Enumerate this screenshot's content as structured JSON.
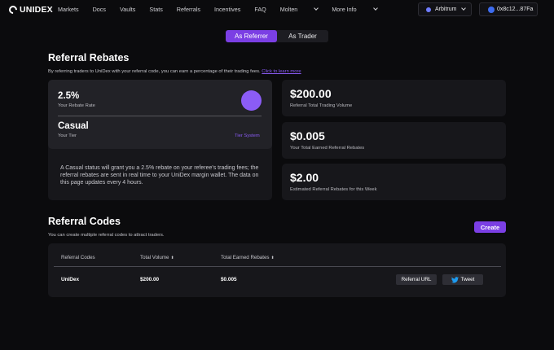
{
  "nav": {
    "brand": "UNIDEX",
    "links": [
      "Markets",
      "Docs",
      "Vaults",
      "Stats",
      "Referrals",
      "Incentives",
      "FAQ",
      "Molten",
      "More Info"
    ],
    "network": "Arbitrum",
    "wallet": "0x8c12...87Fa"
  },
  "toggle": {
    "referrer": "As Referrer",
    "trader": "As Trader",
    "active": "referrer"
  },
  "rebates": {
    "title": "Referral Rebates",
    "subtitle": "By referring traders to UniDex with your referral code, you can earn a percentage of their trading fees.",
    "learn_more": "Click to learn more",
    "rate_value": "2.5%",
    "rate_label": "Your Rebate Rate",
    "tier_value": "Casual",
    "tier_label": "Your Tier",
    "tier_link": "Tier System",
    "description": "A Casual status will grant you a 2.5% rebate on your referee's trading fees; the referral rebates are sent in real time to your UniDex margin wallet. The data on this page updates every 4 hours."
  },
  "stats": [
    {
      "value": "$200.00",
      "label": "Referral Total Trading Volume"
    },
    {
      "value": "$0.005",
      "label": "Your Total Earned Referral Rebates"
    },
    {
      "value": "$2.00",
      "label": "Estimated Referral Rebates for this Week"
    }
  ],
  "codes": {
    "title": "Referral Codes",
    "subtitle": "You can create multiple referral codes to attract traders.",
    "create_label": "Create",
    "headers": [
      "Referral Codes",
      "Total Volume",
      "Total Earned Rebates"
    ],
    "sort_glyph": "⬍",
    "rows": [
      {
        "code": "UniDex",
        "volume": "$200.00",
        "rebates": "$0.005",
        "ref_url_label": "Referral URL",
        "tweet_label": "Tweet"
      }
    ]
  },
  "colors": {
    "accent": "#7b3fe4",
    "accent_light": "#8b5cf6",
    "background": "#0b0b0d",
    "card": "#17171b"
  }
}
